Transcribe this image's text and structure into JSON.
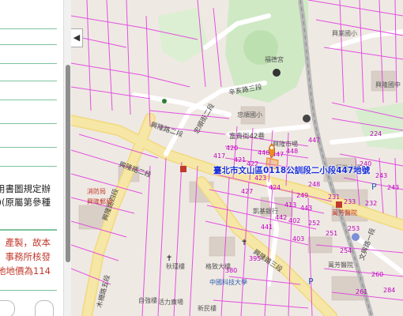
{
  "left_panel": {
    "lines_black": [
      "用書圖規定辦",
      ")(原屬第參種"
    ],
    "lines_red": [
      "產製，故本",
      "事務所核發",
      "地地價為114"
    ],
    "bottom_icon": "refresh-icon"
  },
  "map": {
    "callout_text": "臺北市文山區0118公訓段二小段447地號",
    "collapse_glyph": "◀",
    "colors": {
      "parcel": "#e040e0",
      "road_main": "#f7e7a6",
      "park": "#cfe9c5",
      "building": "#d9cfc6",
      "rail": "#b8b8b8",
      "marker": "#f08c24"
    },
    "road_labels": [
      "興隆路二段",
      "辛亥路三段",
      "興隆路二段",
      "忠順街二段",
      "興隆路四段",
      "木柵路五段",
      "興隆路三段",
      "富貴街42巷",
      "文興路一段"
    ],
    "poi_labels": [
      {
        "text": "福德宮",
        "style": "normal"
      },
      {
        "text": "興業國小",
        "style": "normal"
      },
      {
        "text": "興隆國中",
        "style": "normal"
      },
      {
        "text": "忠順國小",
        "style": "normal"
      },
      {
        "text": "興隆市場",
        "style": "normal"
      },
      {
        "text": "萬芳醫院",
        "style": "red"
      },
      {
        "text": "萬芳醫院",
        "style": "normal"
      },
      {
        "text": "行政大樓",
        "style": "normal"
      },
      {
        "text": "中國科技大學",
        "style": "blue"
      },
      {
        "text": "格致大樓",
        "style": "normal"
      },
      {
        "text": "活力廣場",
        "style": "normal"
      },
      {
        "text": "新民樓",
        "style": "normal"
      },
      {
        "text": "自強樓",
        "style": "normal"
      },
      {
        "text": "秋瑾樓",
        "style": "normal"
      },
      {
        "text": "凱基銀行",
        "style": "normal"
      },
      {
        "text": "消防局",
        "style": "red"
      },
      {
        "text": "興隆郵局",
        "style": "red"
      }
    ],
    "parcel_numbers": [
      "447",
      "446",
      "448",
      "421",
      "422",
      "420",
      "417",
      "423",
      "447",
      "231",
      "233",
      "232",
      "248",
      "240",
      "424",
      "243",
      "249",
      "224",
      "243",
      "251",
      "253",
      "252",
      "413",
      "443",
      "427",
      "402",
      "442",
      "441",
      "254",
      "403",
      "395",
      "260",
      "380",
      "284",
      "261"
    ]
  }
}
